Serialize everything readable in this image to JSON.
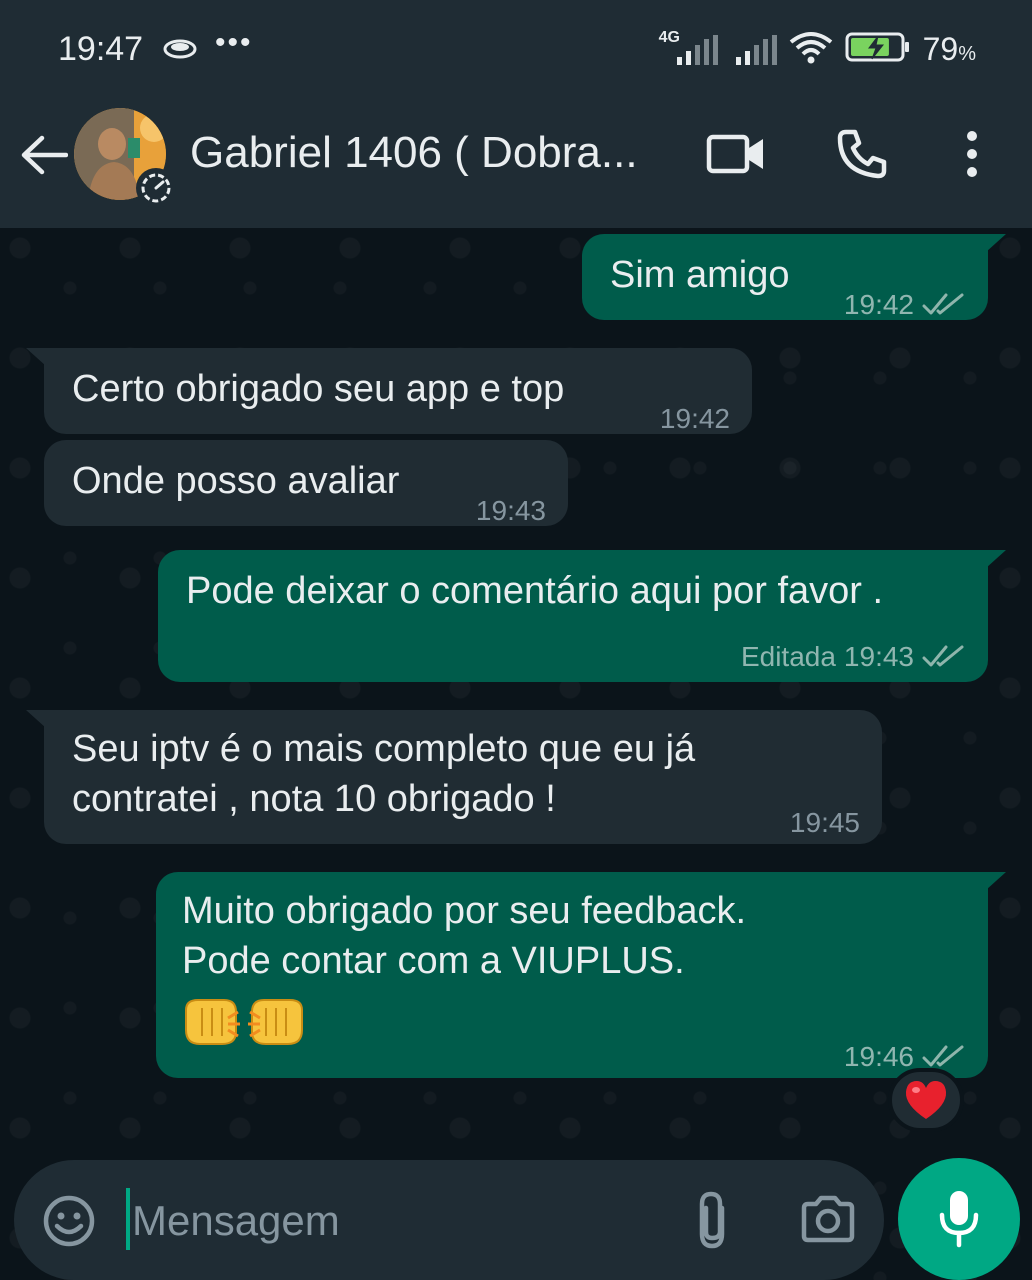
{
  "status_bar": {
    "time": "19:47",
    "dots": "•••",
    "network": "4G",
    "battery_percent": "79",
    "battery_unit": "%",
    "battery_level": 0.79
  },
  "header": {
    "contact_name": "Gabriel 1406 ( Dobra...",
    "icons": [
      "back-arrow-icon",
      "video-call-icon",
      "phone-icon",
      "more-vertical-icon"
    ]
  },
  "messages": [
    {
      "direction": "out",
      "text": "Sim amigo",
      "time": "19:42",
      "edited": "",
      "status": "read"
    },
    {
      "direction": "in",
      "text": "Certo obrigado seu app e top",
      "time": "19:42"
    },
    {
      "direction": "in",
      "text": "Onde posso avaliar",
      "time": "19:43"
    },
    {
      "direction": "out",
      "text": "Pode deixar o comentário aqui por favor .",
      "time": "19:43",
      "edited": "Editada",
      "status": "read"
    },
    {
      "direction": "in",
      "text": "Seu iptv é o mais completo que eu já\ncontratei , nota 10 obrigado !",
      "time": "19:45"
    },
    {
      "direction": "out",
      "text": "Muito obrigado por seu feedback.\nPode contar com a VIUPLUS.",
      "emoji": "🤜🤛",
      "time": "19:46",
      "edited": "",
      "status": "read",
      "reaction": "❤️"
    }
  ],
  "input": {
    "placeholder": "Mensagem"
  },
  "colors": {
    "outgoing_bubble": "#005c4b",
    "incoming_bubble": "#202c33",
    "accent": "#00a884",
    "read_ticks": "#8696a0"
  }
}
